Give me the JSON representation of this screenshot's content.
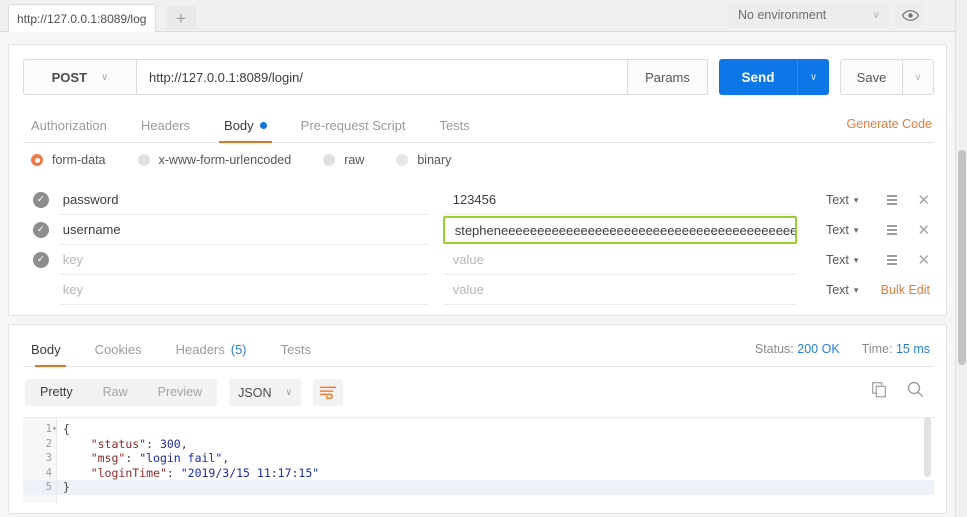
{
  "window": {
    "tab_title": "http://127.0.0.1:8089/log",
    "new_tab_label": "+",
    "environment": {
      "selected": "No environment",
      "caret": "∨"
    },
    "eye_icon": "eye-icon"
  },
  "request": {
    "method": "POST",
    "method_caret": "∨",
    "url": "http://127.0.0.1:8089/login/",
    "params_label": "Params",
    "send_label": "Send",
    "send_caret": "∨",
    "save_label": "Save",
    "save_caret": "∨",
    "tabs": [
      {
        "label": "Authorization",
        "active": false
      },
      {
        "label": "Headers",
        "active": false
      },
      {
        "label": "Body",
        "active": true,
        "dot": true
      },
      {
        "label": "Pre-request Script",
        "active": false
      },
      {
        "label": "Tests",
        "active": false
      }
    ],
    "generate_code_label": "Generate Code",
    "body_types": [
      {
        "label": "form-data",
        "selected": true
      },
      {
        "label": "x-www-form-urlencoded",
        "selected": false
      },
      {
        "label": "raw",
        "selected": false
      },
      {
        "label": "binary",
        "selected": false
      }
    ],
    "kv_headers": {
      "key_placeholder": "key",
      "value_placeholder": "value"
    },
    "kv_rows": [
      {
        "checked": true,
        "key": "password",
        "key_is_placeholder": false,
        "value": "123456",
        "value_is_placeholder": false,
        "type": "Text",
        "type_caret": "▾",
        "focused": false,
        "has_icons": true
      },
      {
        "checked": true,
        "key": "username",
        "key_is_placeholder": false,
        "value": "stepheneeeeeeeeeeeeeeeeeeeeeeeeeeeeeeeeeeeeeeeeeeeeeeeeeeeeeeee",
        "value_is_placeholder": false,
        "type": "Text",
        "type_caret": "▾",
        "focused": true,
        "has_icons": true
      },
      {
        "checked": true,
        "key": "key",
        "key_is_placeholder": true,
        "value": "value",
        "value_is_placeholder": true,
        "type": "Text",
        "type_caret": "▾",
        "focused": false,
        "has_icons": true
      },
      {
        "checked": false,
        "key": "key",
        "key_is_placeholder": true,
        "value": "value",
        "value_is_placeholder": true,
        "type": "Text",
        "type_caret": "▾",
        "focused": false,
        "has_icons": false
      }
    ],
    "bulk_edit_label": "Bulk Edit"
  },
  "response": {
    "tabs": [
      {
        "label": "Body",
        "active": true
      },
      {
        "label": "Cookies",
        "active": false
      },
      {
        "label": "Headers",
        "count": "(5)",
        "active": false
      },
      {
        "label": "Tests",
        "active": false
      }
    ],
    "status_label": "Status:",
    "status_value": "200 OK",
    "time_label": "Time:",
    "time_value": "15 ms",
    "view_modes": [
      {
        "label": "Pretty",
        "active": true
      },
      {
        "label": "Raw",
        "active": false
      },
      {
        "label": "Preview",
        "active": false
      }
    ],
    "format": "JSON",
    "format_caret": "∨",
    "wrap_icon": "word-wrap-icon",
    "copy_icon": "copy-icon",
    "search_icon": "search-icon",
    "code_lines": [
      {
        "num": "1",
        "fold": "▾",
        "highlight": false,
        "tokens": [
          {
            "t": "{",
            "c": "p"
          }
        ]
      },
      {
        "num": "2",
        "fold": "",
        "highlight": false,
        "tokens": [
          {
            "t": "    ",
            "c": "p"
          },
          {
            "t": "\"status\"",
            "c": "k"
          },
          {
            "t": ": ",
            "c": "p"
          },
          {
            "t": "300",
            "c": "n"
          },
          {
            "t": ",",
            "c": "p"
          }
        ]
      },
      {
        "num": "3",
        "fold": "",
        "highlight": false,
        "tokens": [
          {
            "t": "    ",
            "c": "p"
          },
          {
            "t": "\"msg\"",
            "c": "k"
          },
          {
            "t": ": ",
            "c": "p"
          },
          {
            "t": "\"login fail\"",
            "c": "s"
          },
          {
            "t": ",",
            "c": "p"
          }
        ]
      },
      {
        "num": "4",
        "fold": "",
        "highlight": false,
        "tokens": [
          {
            "t": "    ",
            "c": "p"
          },
          {
            "t": "\"loginTime\"",
            "c": "k"
          },
          {
            "t": ": ",
            "c": "p"
          },
          {
            "t": "\"2019/3/15 11:17:15\"",
            "c": "s"
          }
        ]
      },
      {
        "num": "5",
        "fold": "",
        "highlight": true,
        "tokens": [
          {
            "t": "}",
            "c": "p"
          }
        ]
      }
    ]
  },
  "colors": {
    "accent_orange": "#e57325",
    "send_blue": "#0e77e8",
    "status_blue": "#2a7fd4",
    "focus_green": "#9acd32",
    "radio_orange": "#f07946"
  }
}
